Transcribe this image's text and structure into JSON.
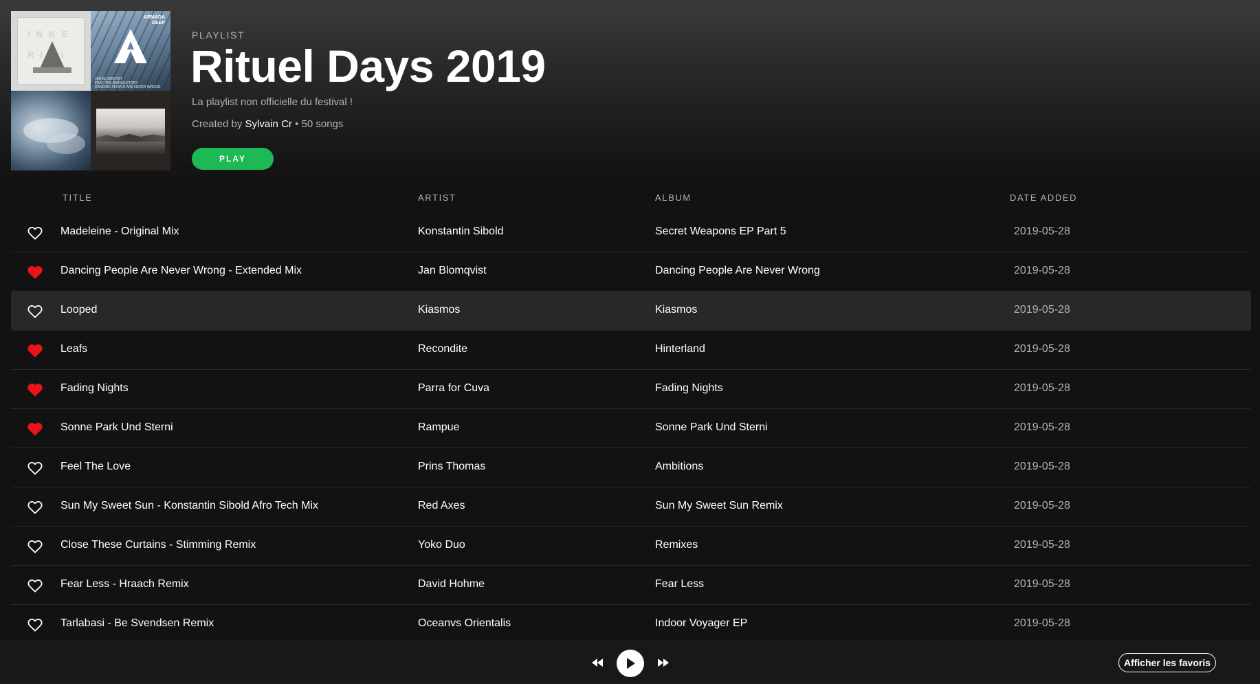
{
  "header": {
    "type_label": "PLAYLIST",
    "title": "Rituel Days 2019",
    "description": "La playlist non officielle du festival !",
    "created_by_label": "Created by",
    "owner": "Sylvain Cr",
    "separator": "•",
    "song_count": "50 songs",
    "play_label": "PLAY",
    "cover_text": {
      "tile2_brand": "ARMADA",
      "tile2_brand_sub": "DEEP",
      "tile2_caption_line1": "JAN BLOMQVIST",
      "tile2_caption_line2": "FEAT. THE BIANCA STORY",
      "tile2_caption_line3": "DANCING PEOPLE ARE NEVER WRONG"
    }
  },
  "columns": {
    "title": "TITLE",
    "artist": "ARTIST",
    "album": "ALBUM",
    "date_added": "DATE ADDED"
  },
  "tracks": [
    {
      "title": "Madeleine - Original Mix",
      "artist": "Konstantin Sibold",
      "album": "Secret Weapons EP Part 5",
      "date_added": "2019-05-28",
      "liked": false
    },
    {
      "title": "Dancing People Are Never Wrong - Extended Mix",
      "artist": "Jan Blomqvist",
      "album": "Dancing People Are Never Wrong",
      "date_added": "2019-05-28",
      "liked": true
    },
    {
      "title": "Looped",
      "artist": "Kiasmos",
      "album": "Kiasmos",
      "date_added": "2019-05-28",
      "liked": false
    },
    {
      "title": "Leafs",
      "artist": "Recondite",
      "album": "Hinterland",
      "date_added": "2019-05-28",
      "liked": true
    },
    {
      "title": "Fading Nights",
      "artist": "Parra for Cuva",
      "album": "Fading Nights",
      "date_added": "2019-05-28",
      "liked": true
    },
    {
      "title": "Sonne Park Und Sterni",
      "artist": "Rampue",
      "album": "Sonne Park Und Sterni",
      "date_added": "2019-05-28",
      "liked": true
    },
    {
      "title": "Feel The Love",
      "artist": "Prins Thomas",
      "album": "Ambitions",
      "date_added": "2019-05-28",
      "liked": false
    },
    {
      "title": "Sun My Sweet Sun - Konstantin Sibold Afro Tech Mix",
      "artist": "Red Axes",
      "album": "Sun My Sweet Sun Remix",
      "date_added": "2019-05-28",
      "liked": false
    },
    {
      "title": "Close These Curtains - Stimming Remix",
      "artist": "Yoko Duo",
      "album": "Remixes",
      "date_added": "2019-05-28",
      "liked": false
    },
    {
      "title": "Fear Less - Hraach Remix",
      "artist": "David Hohme",
      "album": "Fear Less",
      "date_added": "2019-05-28",
      "liked": false
    },
    {
      "title": "Tarlabasi - Be Svendsen Remix",
      "artist": "Oceanvs Orientalis",
      "album": "Indoor Voyager EP",
      "date_added": "2019-05-28",
      "liked": false
    }
  ],
  "player": {
    "prev_icon": "skip-back-icon",
    "play_icon": "play-icon",
    "next_icon": "skip-forward-icon",
    "favorites_label": "Afficher les favoris"
  },
  "colors": {
    "accent_green": "#1db954",
    "heart_red": "#e8141a",
    "background": "#121212",
    "text_muted": "#b3b3b3"
  }
}
